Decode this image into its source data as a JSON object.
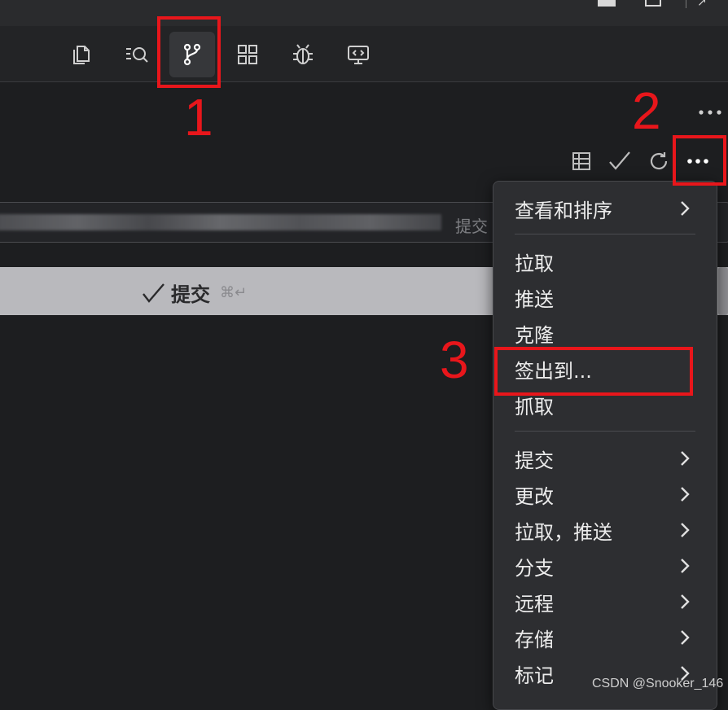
{
  "activity_bar": {
    "items": [
      {
        "icon": "files-icon"
      },
      {
        "icon": "search-icon"
      },
      {
        "icon": "source-control-icon",
        "active": true
      },
      {
        "icon": "extensions-icon"
      },
      {
        "icon": "debug-icon"
      },
      {
        "icon": "remote-explorer-icon"
      }
    ]
  },
  "scm_toolbar": {
    "icons": [
      "table-icon",
      "check-icon",
      "refresh-icon",
      "more-icon"
    ]
  },
  "commit": {
    "input_placeholder": "提交",
    "button_label": "提交",
    "button_shortcut": "⌘↵"
  },
  "menu": {
    "groups": [
      [
        {
          "label": "查看和排序",
          "submenu": true
        }
      ],
      [
        {
          "label": "拉取",
          "submenu": false
        },
        {
          "label": "推送",
          "submenu": false
        },
        {
          "label": "克隆",
          "submenu": false
        },
        {
          "label": "签出到...",
          "submenu": false
        },
        {
          "label": "抓取",
          "submenu": false
        }
      ],
      [
        {
          "label": "提交",
          "submenu": true
        },
        {
          "label": "更改",
          "submenu": true
        },
        {
          "label": "拉取，推送",
          "submenu": true
        },
        {
          "label": "分支",
          "submenu": true
        },
        {
          "label": "远程",
          "submenu": true
        },
        {
          "label": "存储",
          "submenu": true
        },
        {
          "label": "标记",
          "submenu": true
        }
      ]
    ]
  },
  "annotations": {
    "labels": [
      "1",
      "2",
      "3"
    ],
    "color": "#e8161b"
  },
  "watermark": "CSDN @Snooker_146"
}
